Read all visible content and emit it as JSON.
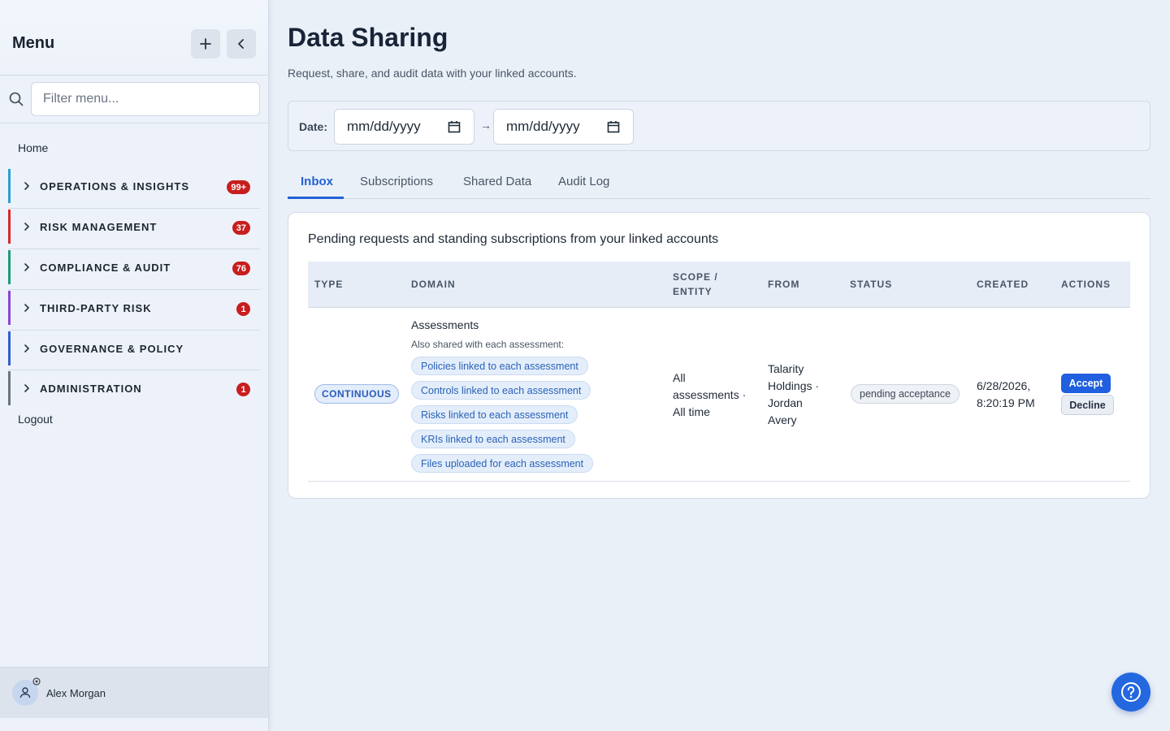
{
  "sidebar": {
    "title": "Menu",
    "add_icon": "plus-icon",
    "collapse_icon": "chevron-left-icon",
    "search_placeholder": "Filter menu...",
    "home_label": "Home",
    "logout_label": "Logout",
    "sections": [
      {
        "label": "OPERATIONS & INSIGHTS",
        "badge": "99+",
        "color": "#2b9fd0"
      },
      {
        "label": "RISK MANAGEMENT",
        "badge": "37",
        "color": "#d62a2a"
      },
      {
        "label": "COMPLIANCE & AUDIT",
        "badge": "76",
        "color": "#1f9a72"
      },
      {
        "label": "THIRD-PARTY RISK",
        "badge": "1",
        "color": "#8a45d6"
      },
      {
        "label": "GOVERNANCE & POLICY",
        "badge": "",
        "color": "#2f5fd0"
      },
      {
        "label": "ADMINISTRATION",
        "badge": "1",
        "color": "#6b7480"
      }
    ],
    "user": {
      "name": "Alex Morgan"
    }
  },
  "header": {
    "title": "Data Sharing",
    "subtitle": "Request, share, and audit data with your linked accounts."
  },
  "filters": {
    "date_label": "Date:",
    "from_placeholder": "mm/dd/yyyy",
    "to_placeholder": "mm/dd/yyyy",
    "separator": "→"
  },
  "tabs": [
    {
      "label": "Inbox",
      "active": true
    },
    {
      "label": "Subscriptions",
      "active": false
    },
    {
      "label": "Shared Data",
      "active": false
    },
    {
      "label": "Audit Log",
      "active": false
    }
  ],
  "inbox": {
    "title": "Pending requests and standing subscriptions from your linked accounts",
    "columns": [
      "TYPE",
      "DOMAIN",
      "SCOPE / ENTITY",
      "FROM",
      "STATUS",
      "CREATED",
      "ACTIONS"
    ],
    "rows": [
      {
        "type": "CONTINUOUS",
        "domain": "Assessments",
        "domain_note": "Also shared with each assessment:",
        "shared_items": [
          "Policies linked to each assessment",
          "Controls linked to each assessment",
          "Risks linked to each assessment",
          "KRIs linked to each assessment",
          "Files uploaded for each assessment"
        ],
        "scope_lines": [
          "All",
          "assessments ·",
          "All time"
        ],
        "from_lines": [
          "Talarity",
          "Holdings ·",
          "Jordan",
          "Avery"
        ],
        "status": "pending acceptance",
        "created_lines": [
          "6/28/2026,",
          "8:20:19 PM"
        ],
        "accept_label": "Accept",
        "decline_label": "Decline"
      }
    ]
  },
  "help_icon": "help-circle-icon",
  "colors": {
    "accent": "#2360d6",
    "badge": "#c81e1e"
  }
}
